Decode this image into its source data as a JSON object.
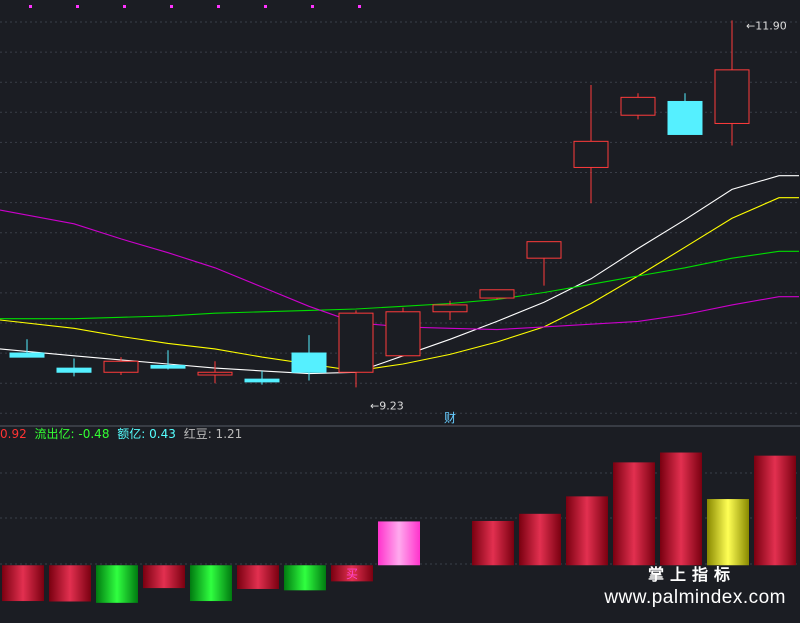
{
  "chart_data": [
    {
      "type": "candlestick",
      "x": [
        1,
        2,
        3,
        4,
        5,
        6,
        7,
        8,
        9,
        10,
        11,
        12,
        13,
        14,
        15,
        16,
        17
      ],
      "ohlc": [
        {
          "open": 9.48,
          "high": 9.58,
          "low": 9.45,
          "close": 9.45
        },
        {
          "open": 9.37,
          "high": 9.44,
          "low": 9.31,
          "close": 9.34
        },
        {
          "open": 9.34,
          "high": 9.45,
          "low": 9.32,
          "close": 9.42
        },
        {
          "open": 9.39,
          "high": 9.5,
          "low": 9.36,
          "close": 9.37
        },
        {
          "open": 9.32,
          "high": 9.42,
          "low": 9.26,
          "close": 9.34
        },
        {
          "open": 9.29,
          "high": 9.35,
          "low": 9.25,
          "close": 9.27
        },
        {
          "open": 9.48,
          "high": 9.61,
          "low": 9.28,
          "close": 9.34
        },
        {
          "open": 9.34,
          "high": 9.79,
          "low": 9.23,
          "close": 9.77
        },
        {
          "open": 9.46,
          "high": 9.81,
          "low": 9.46,
          "close": 9.78
        },
        {
          "open": 9.78,
          "high": 9.86,
          "low": 9.72,
          "close": 9.83
        },
        {
          "open": 9.88,
          "high": 9.93,
          "low": 9.87,
          "close": 9.94
        },
        {
          "open": 10.17,
          "high": 10.29,
          "low": 9.97,
          "close": 10.29
        },
        {
          "open": 10.83,
          "high": 11.43,
          "low": 10.57,
          "close": 11.02
        },
        {
          "open": 11.21,
          "high": 11.37,
          "low": 11.18,
          "close": 11.34
        },
        {
          "open": 11.31,
          "high": 11.37,
          "low": 11.07,
          "close": 11.07
        },
        {
          "open": 11.15,
          "high": 11.9,
          "low": 10.99,
          "close": 11.54
        },
        {
          "open": 11.54,
          "high": 11.54,
          "low": 11.54,
          "close": 11.54
        }
      ],
      "ma_lines": [
        {
          "color": "#ffffff",
          "values": [
            9.51,
            9.46,
            9.43,
            9.4,
            9.37,
            9.35,
            9.33,
            9.34,
            9.46,
            9.58,
            9.71,
            9.85,
            10.02,
            10.24,
            10.45,
            10.67,
            10.77
          ]
        },
        {
          "color": "#ffff00",
          "values": [
            9.72,
            9.66,
            9.6,
            9.55,
            9.51,
            9.45,
            9.4,
            9.35,
            9.4,
            9.47,
            9.56,
            9.67,
            9.84,
            10.04,
            10.25,
            10.46,
            10.61
          ]
        },
        {
          "color": "#00dd00",
          "values": [
            9.73,
            9.73,
            9.74,
            9.75,
            9.77,
            9.78,
            9.79,
            9.8,
            9.82,
            9.84,
            9.87,
            9.92,
            9.98,
            10.04,
            10.1,
            10.17,
            10.22
          ]
        },
        {
          "color": "#cc00cc",
          "values": [
            10.52,
            10.42,
            10.31,
            10.21,
            10.1,
            9.96,
            9.82,
            9.7,
            9.67,
            9.66,
            9.65,
            9.67,
            9.69,
            9.71,
            9.76,
            9.83,
            9.89
          ]
        }
      ],
      "annotations": [
        {
          "text": "11.90",
          "x": 16,
          "y": 11.9
        },
        {
          "text": "9.23",
          "x": 8,
          "y": 9.23
        },
        {
          "text": "财",
          "x": 10
        }
      ],
      "ylim": [
        9.08,
        11.99
      ],
      "grid": true
    },
    {
      "type": "bar",
      "x": [
        1,
        2,
        3,
        4,
        5,
        6,
        7,
        8,
        9,
        10,
        11,
        12,
        13,
        14,
        15,
        16,
        17
      ],
      "series": [
        {
          "values": [
            -0.8,
            -0.81,
            -0.84,
            -0.51,
            -0.8,
            -0.53,
            -0.56,
            -0.36,
            0.98,
            0,
            0.99,
            1.15,
            1.54,
            2.3,
            2.52,
            1.48,
            2.45
          ]
        }
      ],
      "bar_colors": [
        "red",
        "red",
        "green",
        "red",
        "green",
        "red",
        "green",
        "red",
        "magenta",
        "none",
        "red",
        "red",
        "red",
        "red",
        "red",
        "yellow",
        "red"
      ],
      "annotations": [
        {
          "text": "买",
          "x": 8
        }
      ],
      "ylim": [
        -1.0,
        2.8
      ],
      "grid": true
    }
  ],
  "info_bar": [
    {
      "text": "0.92",
      "color": "#ff3333"
    },
    {
      "text": "流出亿: -0.48",
      "color": "#33ff33"
    },
    {
      "text": "额亿: 0.43",
      "color": "#55ffff"
    },
    {
      "text": "红豆: 1.21",
      "color": "#bbbbbb"
    }
  ],
  "watermark": {
    "cn": "掌上指标",
    "url": "www.palmindex.com"
  }
}
